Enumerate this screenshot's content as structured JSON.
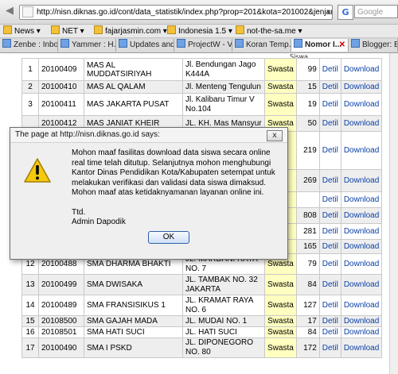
{
  "browser": {
    "url": "http://nisn.diknas.go.id/cont/data_statistik/index.php?prop=201&kota=201002&jenjang=3",
    "search_placeholder": "Google",
    "search_engine_icon": "G",
    "bookmarks": [
      "News",
      "NET",
      "fajarjasmin.com",
      "Indonesia 1.5",
      "not-the-sa.me"
    ],
    "tabs": [
      "Zenbe : Inbo...",
      "Yammer : H...",
      "Updates and...",
      "ProjectW - V...",
      "Koran Temp...",
      "Nomor I...",
      "Blogger: B"
    ],
    "active_tab_index": 5
  },
  "table": {
    "partial_header": "Siswa",
    "rows": [
      {
        "no": "1",
        "npsn": "20100409",
        "name": "MAS AL MUDDATSIRIYAH",
        "address": "Jl. Bendungan Jago K444A",
        "status": "Swasta",
        "count": "99",
        "detail": "Detil",
        "download": "Download"
      },
      {
        "no": "2",
        "npsn": "20100410",
        "name": "MAS AL QALAM",
        "address": "Jl. Menteng Tengulun",
        "status": "Swasta",
        "count": "15",
        "detail": "Detil",
        "download": "Download"
      },
      {
        "no": "3",
        "npsn": "20100411",
        "name": "MAS JAKARTA PUSAT",
        "address": "Jl. Kalibaru Timur V No.104",
        "status": "Swasta",
        "count": "19",
        "detail": "Detil",
        "download": "Download"
      },
      {
        "no": "",
        "npsn": "20100412",
        "name": "MAS JANIAT KHEIR",
        "address": "JL. KH. Mas Mansyur",
        "status": "Swasta",
        "count": "50",
        "detail": "Detil",
        "download": "Download"
      },
      {
        "no": "",
        "npsn": "",
        "name": "",
        "address": "",
        "status": "",
        "count": "219",
        "detail": "Detil",
        "download": "Download"
      },
      {
        "no": "",
        "npsn": "",
        "name": "",
        "address": "",
        "status": "",
        "count": "269",
        "detail": "Detil",
        "download": "Download"
      },
      {
        "no": "",
        "npsn": "",
        "name": "",
        "address": "",
        "status": "",
        "count": "",
        "detail": "Detil",
        "download": "Download"
      },
      {
        "no": "",
        "npsn": "",
        "name": "",
        "address": "",
        "status": "",
        "count": "808",
        "detail": "Detil",
        "download": "Download"
      },
      {
        "no": "",
        "npsn": "",
        "name": "",
        "address": "",
        "status": "",
        "count": "281",
        "detail": "Detil",
        "download": "Download"
      },
      {
        "no": "",
        "npsn": "",
        "name": "",
        "address": "BARAT XXI",
        "status": "",
        "count": "165",
        "detail": "Detil",
        "download": "Download"
      },
      {
        "no": "12",
        "npsn": "20100488",
        "name": "SMA DHARMA BHAKTI",
        "address": "JL. MARDANI RAYA NO. 7",
        "status": "Swasta",
        "count": "79",
        "detail": "Detil",
        "download": "Download"
      },
      {
        "no": "13",
        "npsn": "20100499",
        "name": "SMA DWISAKA",
        "address": "JL. TAMBAK NO. 32 JAKARTA",
        "status": "Swasta",
        "count": "84",
        "detail": "Detil",
        "download": "Download"
      },
      {
        "no": "14",
        "npsn": "20100489",
        "name": "SMA FRANSISIKUS 1",
        "address": "JL. KRAMAT RAYA NO. 6",
        "status": "Swasta",
        "count": "127",
        "detail": "Detil",
        "download": "Download"
      },
      {
        "no": "15",
        "npsn": "20108500",
        "name": "SMA GAJAH MADA",
        "address": "JL. MUDAI NO. 1",
        "status": "Swasta",
        "count": "17",
        "detail": "Detil",
        "download": "Download"
      },
      {
        "no": "16",
        "npsn": "20108501",
        "name": "SMA HATI SUCI",
        "address": "JL. HATI SUCI",
        "status": "Swasta",
        "count": "84",
        "detail": "Detil",
        "download": "Download"
      },
      {
        "no": "17",
        "npsn": "20100490",
        "name": "SMA I PSKD",
        "address": "JL. DIPONEGORO NO. 80",
        "status": "Swasta",
        "count": "172",
        "detail": "Detil",
        "download": "Download"
      }
    ]
  },
  "dialog": {
    "title": "The page at http://nisn.diknas.go.id says:",
    "close_glyph": "x",
    "message": "Mohon maaf fasilitas download data siswa secara online real time telah ditutup. Selanjutnya mohon menghubungi Kantor Dinas Pendidikan Kota/Kabupaten setempat untuk melakukan verifikasi dan validasi data siswa dimaksud. Mohon maaf atas ketidaknyamanan layanan online ini.",
    "sign_1": "Ttd.",
    "sign_2": "Admin Dapodik",
    "ok_label": "OK",
    "icon": "warning-icon"
  }
}
